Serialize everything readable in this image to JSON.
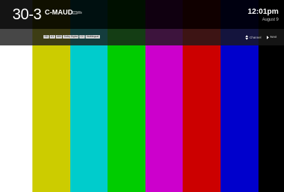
{
  "channel": {
    "number": "30",
    "subchannel": "-3",
    "name": "C-MAUD",
    "icon": "signal-antenna-icon"
  },
  "clock": {
    "time": "12:01pm",
    "date": "August 9"
  },
  "program_tags": [
    "SD",
    "4:3",
    "480i",
    "Dolby Digital",
    "CC",
    "Multilingual"
  ],
  "hints": {
    "channel": {
      "icon": "up-down-arrows-icon",
      "label": "Channel"
    },
    "next": {
      "icon": "right-arrow-icon",
      "label": "Next"
    }
  },
  "color_bars": [
    "#ffffff",
    "#cccc00",
    "#00cccc",
    "#00cc00",
    "#cc00cc",
    "#cc0000",
    "#0000cc",
    "#000000"
  ]
}
